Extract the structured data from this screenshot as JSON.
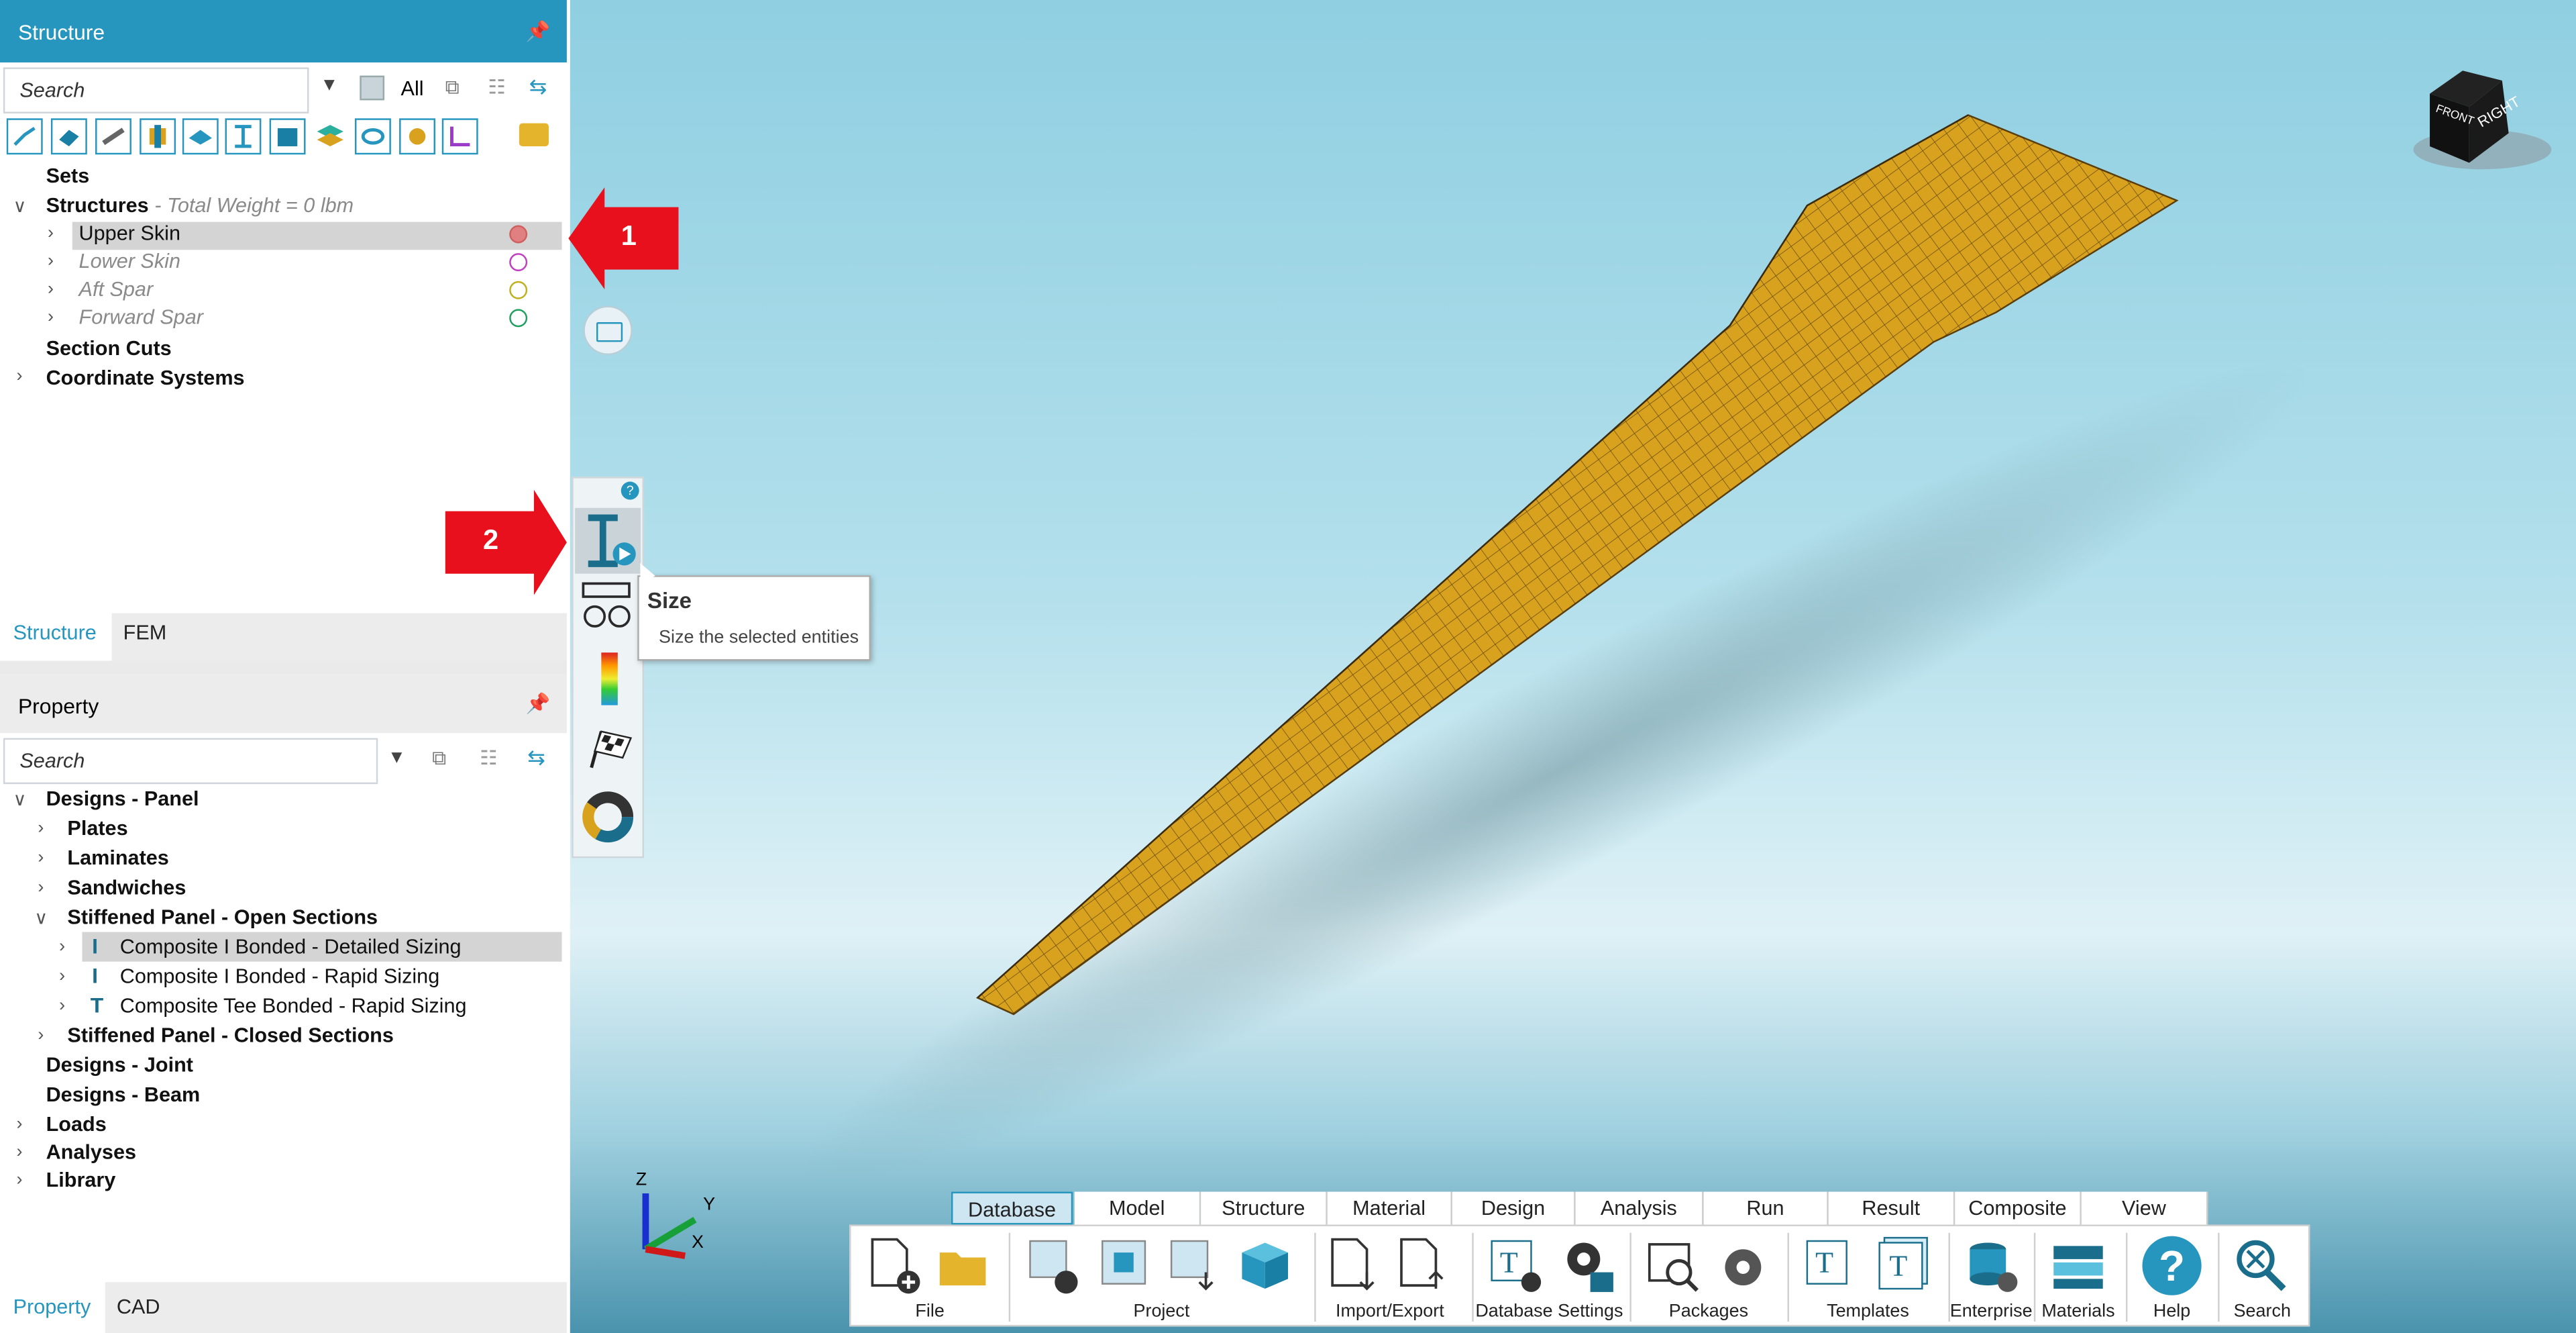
{
  "structure_panel": {
    "title": "Structure",
    "search_placeholder": "Search",
    "filter_label": "All",
    "tree": {
      "sets": "Sets",
      "structures": "Structures",
      "total_weight": "- Total Weight = 0 lbm",
      "items": [
        {
          "label": "Upper Skin",
          "color": "#e06060"
        },
        {
          "label": "Lower Skin",
          "color": "#c040c0"
        },
        {
          "label": "Aft Spar",
          "color": "#c0b020"
        },
        {
          "label": "Forward Spar",
          "color": "#20a060"
        }
      ],
      "section_cuts": "Section Cuts",
      "coordinate_systems": "Coordinate Systems"
    },
    "tabs": [
      "Structure",
      "FEM"
    ]
  },
  "property_panel": {
    "title": "Property",
    "search_placeholder": "Search",
    "tree": {
      "designs_panel": "Designs - Panel",
      "plates": "Plates",
      "laminates": "Laminates",
      "sandwiches": "Sandwiches",
      "stiffened_open": "Stiffened Panel - Open Sections",
      "open_items": [
        "Composite I Bonded - Detailed Sizing",
        "Composite I Bonded - Rapid Sizing",
        "Composite Tee Bonded - Rapid Sizing"
      ],
      "stiffened_closed": "Stiffened Panel - Closed Sections",
      "designs_joint": "Designs - Joint",
      "designs_beam": "Designs - Beam",
      "loads": "Loads",
      "analyses": "Analyses",
      "library": "Library"
    },
    "tabs": [
      "Property",
      "CAD"
    ]
  },
  "annotations": {
    "arrow1": "1",
    "arrow2": "2",
    "arrow_color": "#e8101c"
  },
  "tooltip": {
    "title": "Size",
    "description": "Size the selected entities"
  },
  "view_cube": {
    "face1": "FRONT",
    "face2": "RIGHT"
  },
  "axes": {
    "z": "Z",
    "y": "Y",
    "x": "X"
  },
  "ribbon": {
    "tabs": [
      "Database",
      "Model",
      "Structure",
      "Material",
      "Design",
      "Analysis",
      "Run",
      "Result",
      "Composite",
      "View"
    ],
    "active_tab": "Database",
    "groups": [
      "File",
      "Project",
      "Import/Export",
      "Database Settings",
      "Packages",
      "Templates",
      "Enterprise",
      "Materials",
      "Help",
      "Search"
    ]
  },
  "colors": {
    "accent": "#2696bf",
    "wing": "#d9a21e"
  }
}
